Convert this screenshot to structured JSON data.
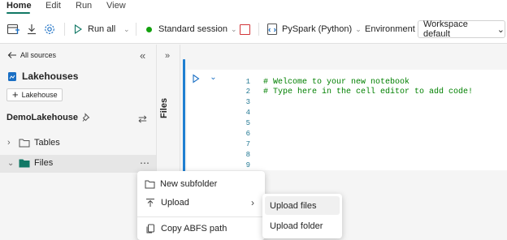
{
  "menu": {
    "tabs": [
      {
        "label": "Home",
        "active": true
      },
      {
        "label": "Edit"
      },
      {
        "label": "Run"
      },
      {
        "label": "View"
      }
    ]
  },
  "toolbar": {
    "run_all_label": "Run all",
    "session_label": "Standard session",
    "session_status_color": "#13a10e",
    "stop_color": "#d13438",
    "language_label": "PySpark (Python)",
    "environment_label": "Environment",
    "workspace_label": "Workspace default"
  },
  "explorer": {
    "back_label": "All sources",
    "lakehouses_title": "Lakehouses",
    "add_lakehouse_label": "Lakehouse",
    "lakehouse_name": "DemoLakehouse",
    "tree": [
      {
        "label": "Tables",
        "expanded": false
      },
      {
        "label": "Files",
        "expanded": true
      }
    ]
  },
  "rail": {
    "files_label": "Files"
  },
  "editor": {
    "line_numbers": [
      "1",
      "2",
      "3",
      "4",
      "5",
      "6",
      "7",
      "8",
      "9"
    ],
    "code_lines": [
      "# Welcome to your new notebook",
      "# Type here in the cell editor to add code!"
    ]
  },
  "context_menu": {
    "items": [
      {
        "label": "New subfolder",
        "icon": "folder-icon"
      },
      {
        "label": "Upload",
        "icon": "upload-icon"
      },
      {
        "label": "Copy ABFS path",
        "icon": "copy-icon"
      }
    ]
  },
  "submenu": {
    "items": [
      {
        "label": "Upload files"
      },
      {
        "label": "Upload folder"
      }
    ]
  },
  "colors": {
    "accent_teal": "#117865",
    "cell_focus_blue": "#1f7fd1",
    "comment_green": "#008000"
  }
}
